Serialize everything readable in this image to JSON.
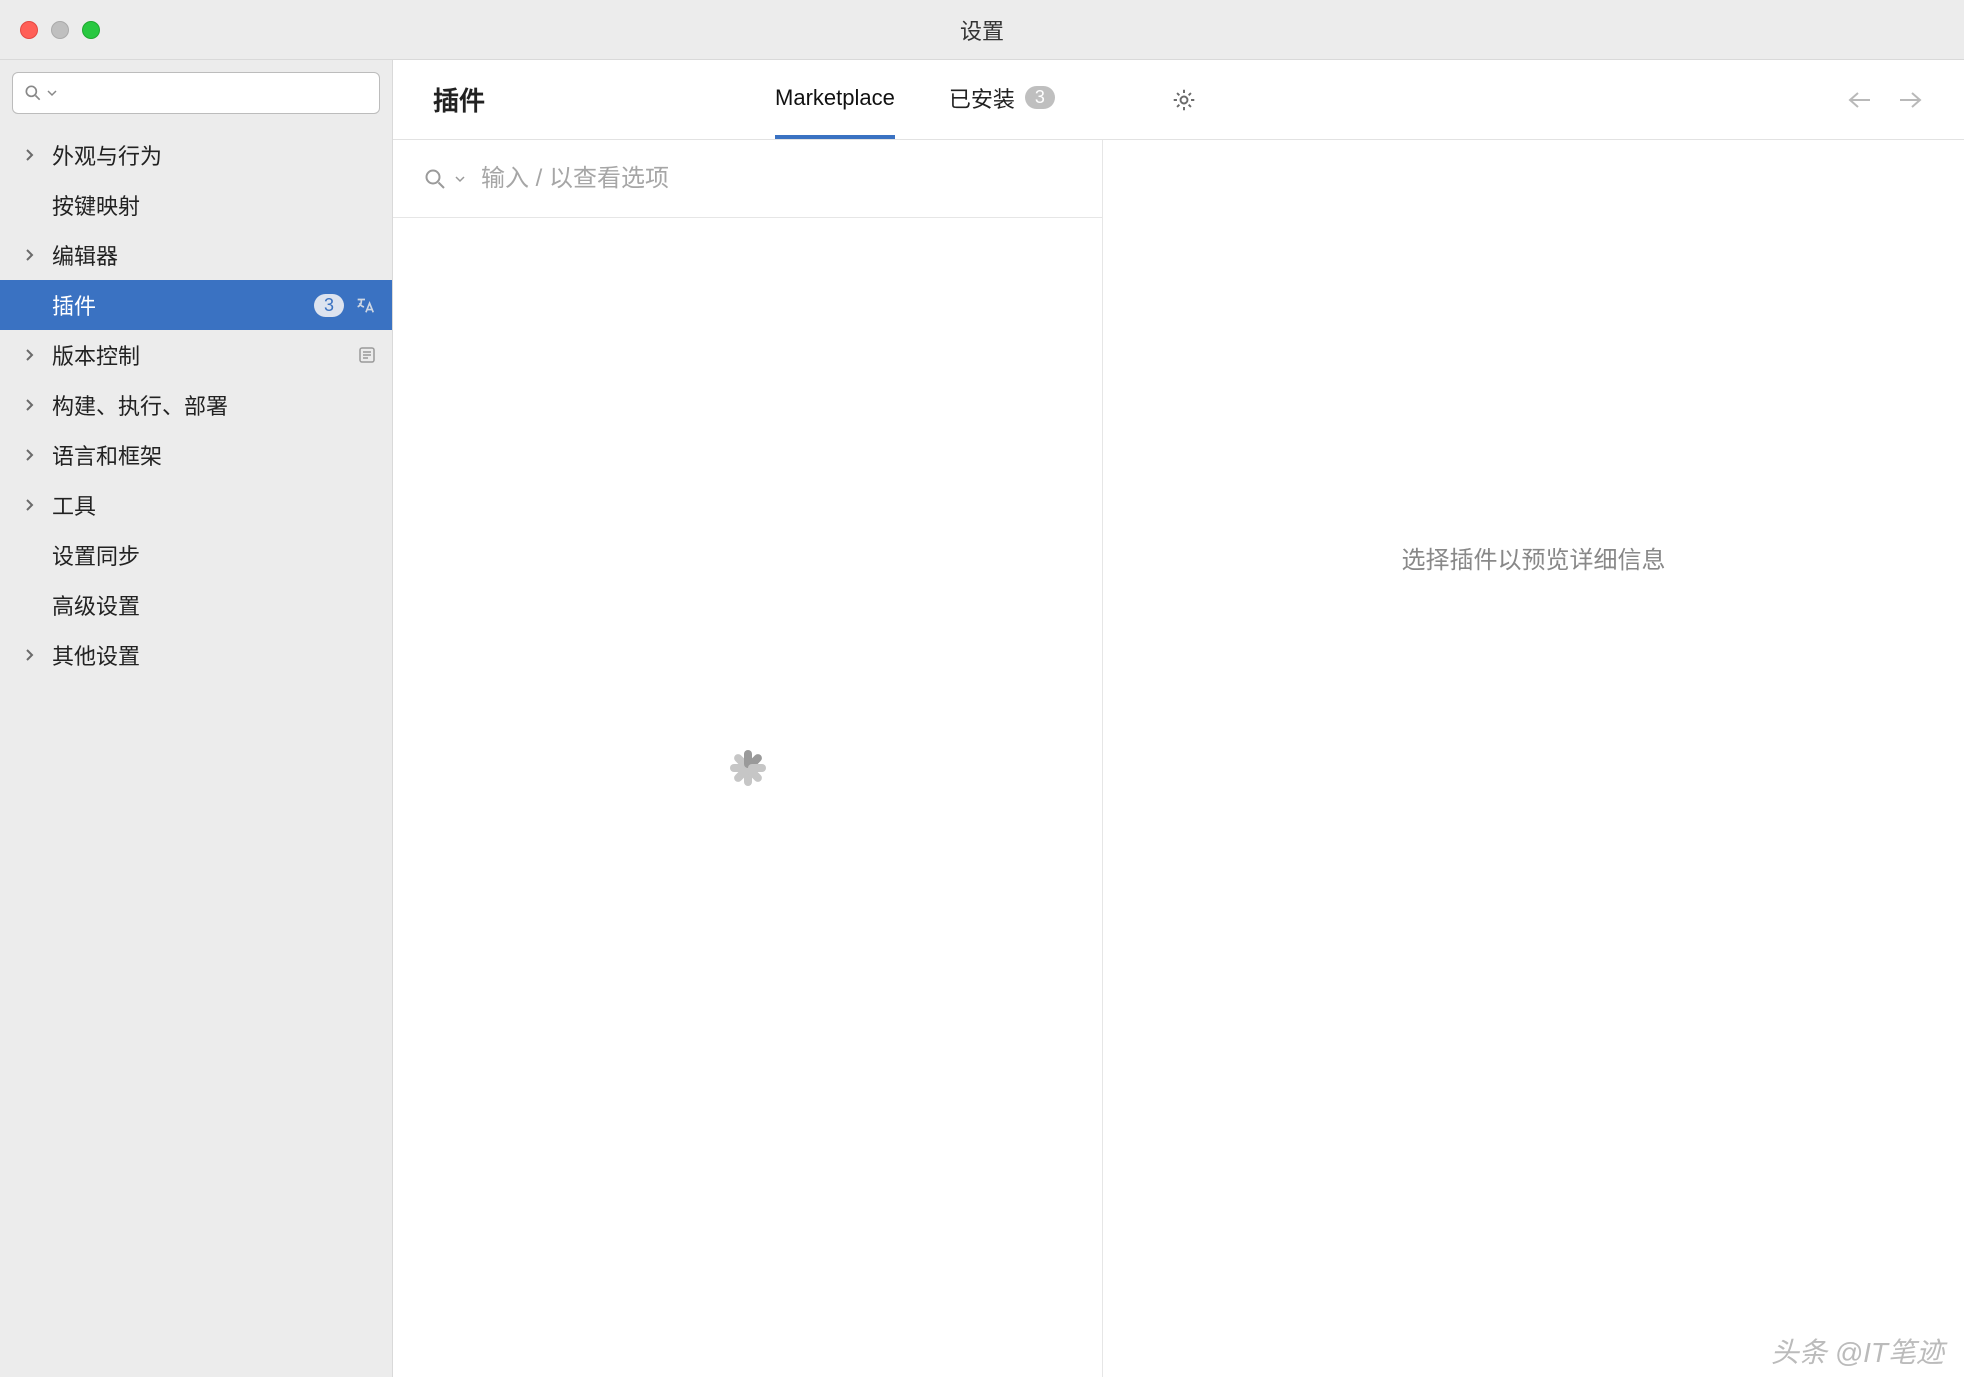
{
  "window": {
    "title": "设置"
  },
  "sidebar": {
    "search_placeholder": "",
    "items": [
      {
        "label": "外观与行为",
        "expandable": true
      },
      {
        "label": "按键映射",
        "expandable": false
      },
      {
        "label": "编辑器",
        "expandable": true
      },
      {
        "label": "插件",
        "expandable": false,
        "selected": true,
        "badge": "3",
        "lang_icon": true
      },
      {
        "label": "版本控制",
        "expandable": true,
        "project_icon": true
      },
      {
        "label": "构建、执行、部署",
        "expandable": true
      },
      {
        "label": "语言和框架",
        "expandable": true
      },
      {
        "label": "工具",
        "expandable": true
      },
      {
        "label": "设置同步",
        "expandable": false
      },
      {
        "label": "高级设置",
        "expandable": false
      },
      {
        "label": "其他设置",
        "expandable": true
      }
    ]
  },
  "main": {
    "title": "插件",
    "tabs": {
      "marketplace": "Marketplace",
      "installed": "已安装",
      "installed_badge": "3"
    },
    "plugin_search_placeholder": "输入 / 以查看选项",
    "detail_empty": "选择插件以预览详细信息"
  },
  "watermark": "头条 @IT笔迹"
}
